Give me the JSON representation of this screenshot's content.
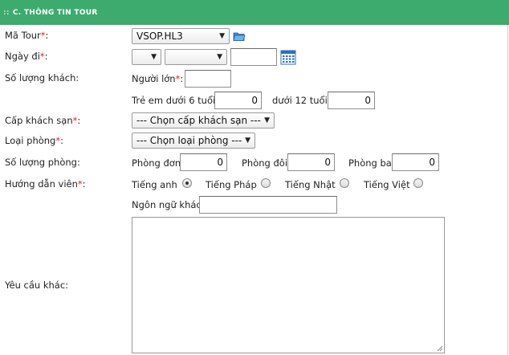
{
  "section": {
    "dots": "::",
    "title": "C. THÔNG TIN TOUR"
  },
  "tour": {
    "label": "Mã Tour",
    "required_mark": "*",
    "selected": "VSOP.HL3",
    "icon": "folder-open-icon"
  },
  "date": {
    "label": "Ngày đi",
    "required_mark": "*",
    "day": "",
    "month": "",
    "year": "",
    "icon": "calendar-icon"
  },
  "guests": {
    "label": "Số lượng khách:",
    "adults_label": "Người lớn",
    "required_mark": "*",
    "adults": "",
    "child6_label": "Trẻ em dưới 6 tuổi",
    "child6": "0",
    "child12_label": "dưới 12 tuổi",
    "child12": "0"
  },
  "hotel": {
    "label": "Cấp khách sạn",
    "required_mark": "*",
    "selected": "--- Chọn cấp khách sạn ---"
  },
  "room_type": {
    "label": "Loại phòng",
    "required_mark": "*",
    "selected": "--- Chọn loại phòng ---"
  },
  "rooms": {
    "label": "Số lượng phòng:",
    "single_label": "Phòng đơn",
    "single": "0",
    "double_label": "Phòng đôi",
    "double": "0",
    "triple_label": "Phòng ba",
    "triple": "0"
  },
  "guide": {
    "label": "Hướng dẫn viên",
    "required_mark": "*",
    "options": [
      "Tiếng anh",
      "Tiếng Pháp",
      "Tiếng Nhật",
      "Tiếng Việt"
    ],
    "selected": "Tiếng anh",
    "other_label": "Ngôn ngữ khác",
    "other": ""
  },
  "other_requests": {
    "label": "Yêu cầu khác:",
    "value": ""
  },
  "colors": {
    "header": "#3dab6e",
    "required": "#e02020"
  }
}
